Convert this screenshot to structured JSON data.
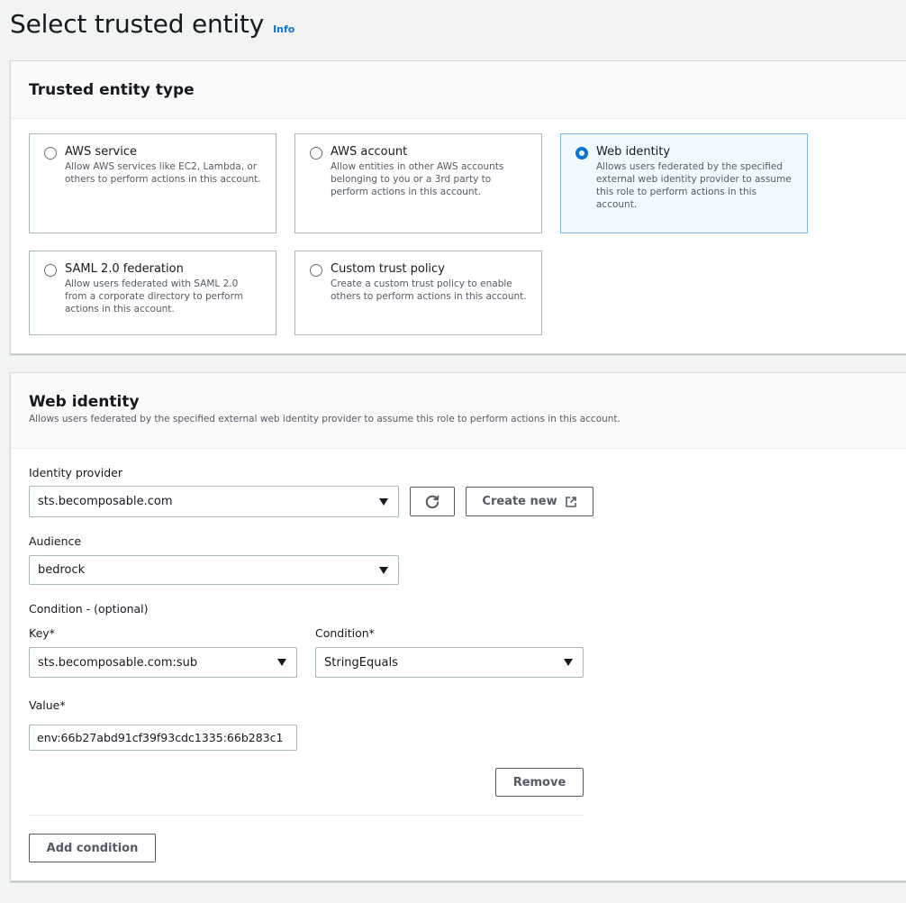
{
  "page": {
    "title": "Select trusted entity",
    "info_label": "Info"
  },
  "trusted_entity": {
    "heading": "Trusted entity type",
    "options": [
      {
        "title": "AWS service",
        "description": "Allow AWS services like EC2, Lambda, or others to perform actions in this account.",
        "selected": false
      },
      {
        "title": "AWS account",
        "description": "Allow entities in other AWS accounts belonging to you or a 3rd party to perform actions in this account.",
        "selected": false
      },
      {
        "title": "Web identity",
        "description": "Allows users federated by the specified external web identity provider to assume this role to perform actions in this account.",
        "selected": true
      },
      {
        "title": "SAML 2.0 federation",
        "description": "Allow users federated with SAML 2.0 from a corporate directory to perform actions in this account.",
        "selected": false
      },
      {
        "title": "Custom trust policy",
        "description": "Create a custom trust policy to enable others to perform actions in this account.",
        "selected": false
      }
    ]
  },
  "web_identity": {
    "heading": "Web identity",
    "description": "Allows users federated by the specified external web identity provider to assume this role to perform actions in this account.",
    "identity_provider": {
      "label": "Identity provider",
      "value": "sts.becomposable.com"
    },
    "refresh_icon": "refresh-icon",
    "create_new_label": "Create new",
    "external_link_icon": "external-link-icon",
    "audience": {
      "label": "Audience",
      "value": "bedrock"
    },
    "condition": {
      "section_label": "Condition - (optional)",
      "key_label": "Key*",
      "key_value": "sts.becomposable.com:sub",
      "condition_label": "Condition*",
      "condition_value": "StringEquals",
      "value_label": "Value*",
      "value": "env:66b27abd91cf39f93cdc1335:66b283c1"
    },
    "remove_label": "Remove",
    "add_condition_label": "Add condition"
  },
  "colors": {
    "accent": "#0972d3",
    "selected_tile_bg": "#f1faff",
    "page_bg": "#f2f3f3"
  }
}
